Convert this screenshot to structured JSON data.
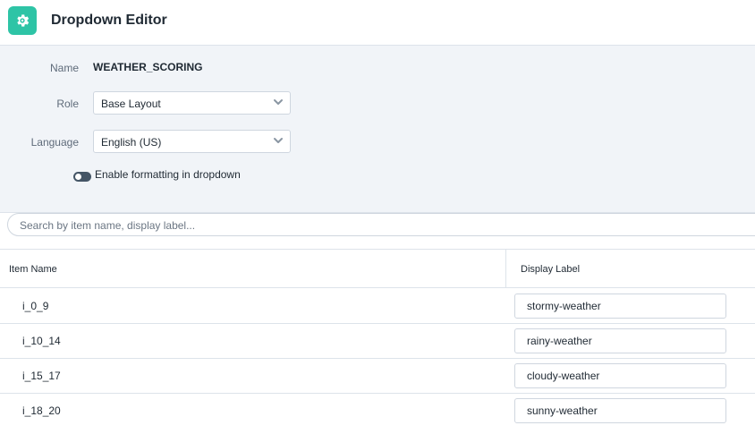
{
  "header": {
    "title": "Dropdown Editor",
    "icon": "gear-icon",
    "accent": "#2ec4a6"
  },
  "form": {
    "name_label": "Name",
    "name_value": "WEATHER_SCORING",
    "role_label": "Role",
    "role_value": "Base Layout",
    "language_label": "Language",
    "language_value": "English (US)",
    "toggle_label": "Enable formatting in dropdown",
    "toggle_on": false
  },
  "search": {
    "placeholder": "Search by item name, display label..."
  },
  "table": {
    "headers": {
      "item_name": "Item Name",
      "display_label": "Display Label"
    },
    "rows": [
      {
        "item": "i_0_9",
        "label": "stormy-weather"
      },
      {
        "item": "i_10_14",
        "label": "rainy-weather"
      },
      {
        "item": "i_15_17",
        "label": "cloudy-weather"
      },
      {
        "item": "i_18_20",
        "label": "sunny-weather"
      }
    ]
  }
}
